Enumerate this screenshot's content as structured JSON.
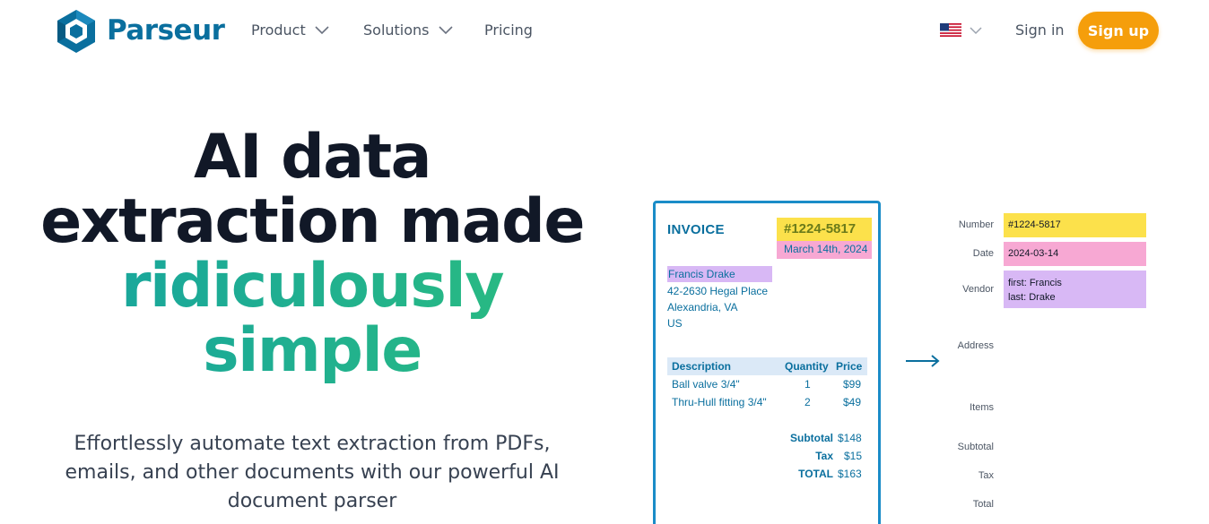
{
  "nav": {
    "brand": "Parseur",
    "items": [
      {
        "label": "Product",
        "has_dropdown": true
      },
      {
        "label": "Solutions",
        "has_dropdown": true
      },
      {
        "label": "Pricing",
        "has_dropdown": false
      }
    ],
    "language_icon": "us-flag-icon",
    "signin_label": "Sign in",
    "signup_label": "Sign up"
  },
  "hero": {
    "title_line1": "AI data",
    "title_line2": "extraction made",
    "title_line3": "ridiculously",
    "title_line4": "simple",
    "subtitle": "Effortlessly automate text extraction from PDFs, emails, and other documents with our powerful AI document parser"
  },
  "invoice": {
    "title": "INVOICE",
    "number": "#1224-5817",
    "date": "March 14th, 2024",
    "address": [
      "Francis Drake",
      "42-2630 Hegal Place",
      "Alexandria, VA",
      "US"
    ],
    "columns": [
      "Description",
      "Quantity",
      "Price"
    ],
    "rows": [
      {
        "description": "Ball valve 3/4\"",
        "quantity": "1",
        "price": "$99"
      },
      {
        "description": "Thru-Hull fitting 3/4\"",
        "quantity": "2",
        "price": "$49"
      }
    ],
    "totals": [
      {
        "label": "Subtotal",
        "value": "$148"
      },
      {
        "label": "Tax",
        "value": "$15"
      },
      {
        "label": "TOTAL",
        "value": "$163"
      }
    ]
  },
  "extracted": {
    "labels": {
      "number": "Number",
      "date": "Date",
      "vendor": "Vendor",
      "address": "Address",
      "items": "Items",
      "subtotal": "Subtotal",
      "tax": "Tax",
      "total": "Total"
    },
    "number": "#1224-5817",
    "date": "2024-03-14",
    "vendor_first": "first: Francis",
    "vendor_last": "last: Drake"
  },
  "colors": {
    "brand_blue": "#0a6f9e",
    "signup_orange": "#f59e0b",
    "highlight_yellow": "#fce14b",
    "highlight_pink": "#f7a8d3",
    "highlight_purple": "#d8b8f5",
    "gradient_start": "#16a3a0",
    "gradient_end": "#2bbd7e"
  }
}
